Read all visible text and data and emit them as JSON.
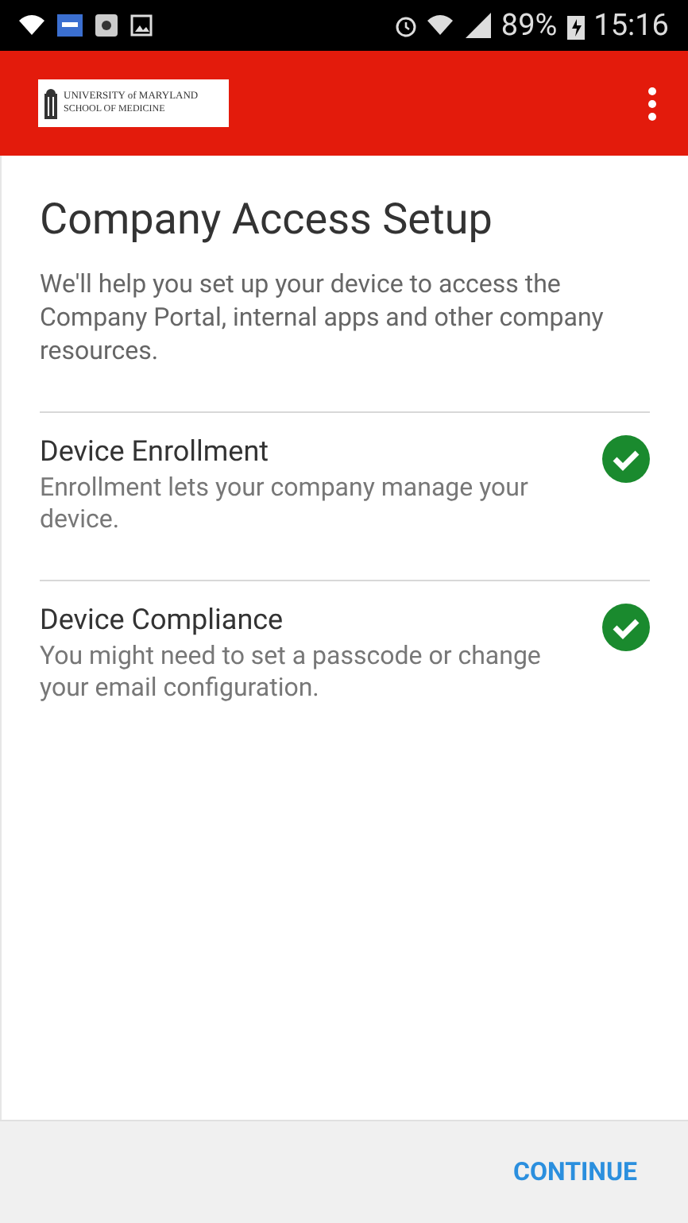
{
  "status_bar": {
    "battery": "89%",
    "time": "15:16"
  },
  "app_bar": {
    "logo": {
      "line_1": "UNIVERSITY of MARYLAND",
      "line_2": "SCHOOL OF MEDICINE"
    }
  },
  "title": "Company Access Setup",
  "description": "We'll help you set up your device to access the Company Portal, internal apps and other company resources.",
  "steps": [
    {
      "title": "Device Enrollment",
      "description": "Enrollment lets your company manage your device.",
      "done": true
    },
    {
      "title": "Device Compliance",
      "description": "You might need to set a passcode or change your email configuration.",
      "done": true
    }
  ],
  "footer": {
    "button": "CONTINUE"
  }
}
